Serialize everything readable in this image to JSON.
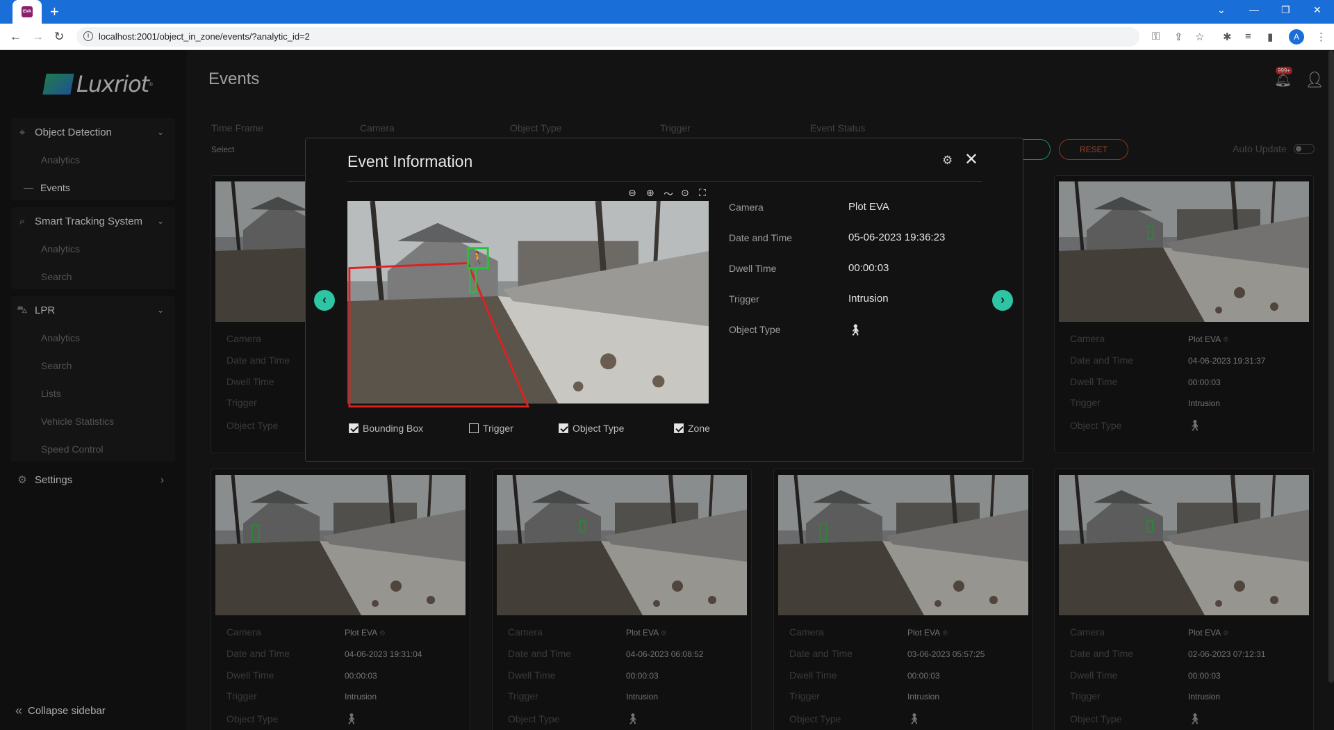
{
  "browser": {
    "favicon": "EVA",
    "url": "localhost:2001/object_in_zone/events/?analytic_id=2",
    "account_initial": "A",
    "icons": [
      "back-arrow-icon",
      "forward-arrow-icon",
      "reload-icon",
      "info-icon",
      "key-icon",
      "share-icon",
      "star-icon",
      "puzzle-icon",
      "media-icon",
      "sidepanel-icon",
      "more-icon"
    ]
  },
  "brand": {
    "name": "Luxriot",
    "reg": "®"
  },
  "page_title": "Events",
  "notifications": {
    "badge": "999+"
  },
  "sidebar": {
    "groups": [
      {
        "label": "Object Detection",
        "icon": "crosshair-icon",
        "items": [
          "Analytics",
          "Events"
        ]
      },
      {
        "label": "Smart Tracking System",
        "icon": "search-icon",
        "items": [
          "Analytics",
          "Search"
        ]
      },
      {
        "label": "LPR",
        "icon": "car-icon",
        "items": [
          "Analytics",
          "Search",
          "Lists",
          "Vehicle Statistics",
          "Speed Control"
        ]
      }
    ],
    "active_item": "Events",
    "settings_label": "Settings",
    "collapse_label": "Collapse sidebar"
  },
  "filters": {
    "labels": [
      "Time Frame",
      "Camera",
      "Object Type",
      "Trigger",
      "Event Status"
    ],
    "time_frame_value": "Select",
    "reset_label": "RESET",
    "auto_update_label": "Auto Update"
  },
  "card_labels": [
    "Camera",
    "Date and Time",
    "Dwell Time",
    "Trigger",
    "Object Type"
  ],
  "cards": [
    {
      "camera": "Plot EVA",
      "datetime": "04-06-2023 19:31:37",
      "dwell": "00:00:03",
      "trigger": "Intrusion",
      "object_icon": "person-walking-icon"
    },
    {
      "camera": "Plot EVA",
      "datetime": "04-06-2023 19:31:04",
      "dwell": "00:00:03",
      "trigger": "Intrusion",
      "object_icon": "person-walking-icon"
    },
    {
      "camera": "Plot EVA",
      "datetime": "04-06-2023 06:08:52",
      "dwell": "00:00:03",
      "trigger": "Intrusion",
      "object_icon": "person-walking-icon"
    },
    {
      "camera": "Plot EVA",
      "datetime": "03-06-2023 05:57:25",
      "dwell": "00:00:03",
      "trigger": "Intrusion",
      "object_icon": "person-walking-icon"
    },
    {
      "camera": "Plot EVA",
      "datetime": "02-06-2023 07:12:31",
      "dwell": "00:00:03",
      "trigger": "Intrusion",
      "object_icon": "person-walking-icon"
    }
  ],
  "modal": {
    "title": "Event Information",
    "tool_icons": [
      "zoom-out-icon",
      "zoom-in-icon",
      "pan-icon",
      "target-icon",
      "fullscreen-icon"
    ],
    "fields": [
      {
        "label": "Camera",
        "value": "Plot EVA"
      },
      {
        "label": "Date and Time",
        "value": "05-06-2023 19:36:23"
      },
      {
        "label": "Dwell Time",
        "value": "00:00:03"
      },
      {
        "label": "Trigger",
        "value": "Intrusion"
      },
      {
        "label": "Object Type",
        "value": ""
      }
    ],
    "checkboxes": [
      {
        "label": "Bounding Box",
        "checked": true
      },
      {
        "label": "Trigger",
        "checked": false
      },
      {
        "label": "Object Type",
        "checked": true
      },
      {
        "label": "Zone",
        "checked": true
      }
    ]
  },
  "colors": {
    "accent": "#2ec4a4",
    "reset": "#c95a38",
    "zone": "#e02020",
    "bbox": "#28c23a"
  }
}
